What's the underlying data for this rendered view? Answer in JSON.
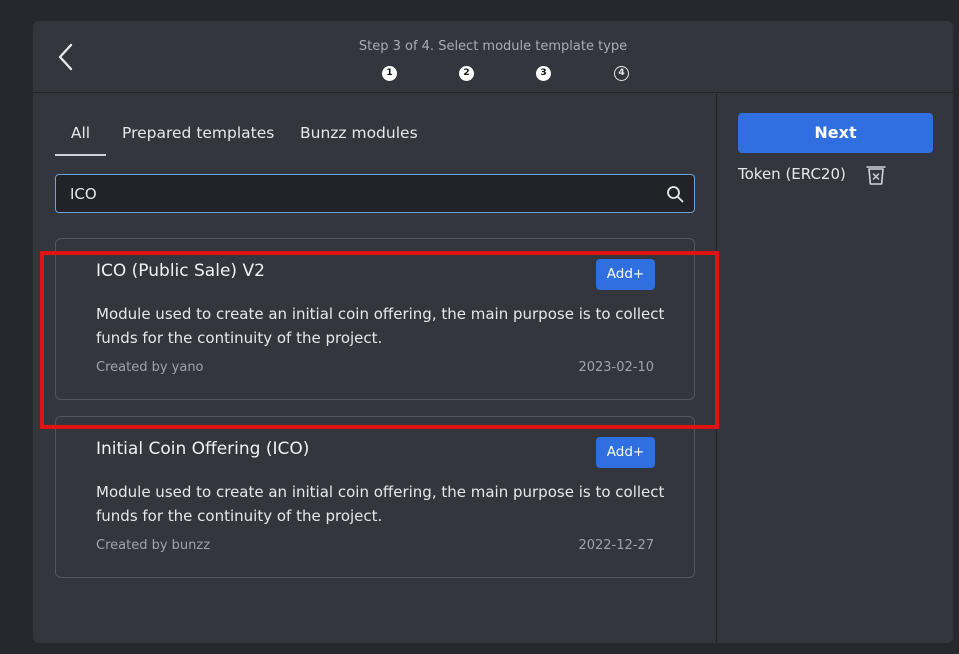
{
  "header": {
    "step_title": "Step 3 of 4. Select module template type",
    "steps": [
      "1",
      "2",
      "3",
      "4"
    ],
    "back_icon": "chevron-left-icon"
  },
  "tabs": [
    {
      "label": "All",
      "active": true
    },
    {
      "label": "Prepared templates",
      "active": false
    },
    {
      "label": "Bunzz modules",
      "active": false
    }
  ],
  "search": {
    "value": "ICO",
    "icon": "search-icon"
  },
  "cards": [
    {
      "title": "ICO (Public Sale) V2",
      "add_label": "Add+",
      "description": "Module used to create an initial coin offering, the main purpose is to collect funds for the continuity of the project.",
      "author": "Created by yano",
      "date": "2023-02-10"
    },
    {
      "title": "Initial Coin Offering (ICO)",
      "add_label": "Add+",
      "description": "Module used to create an initial coin offering, the main purpose is to collect funds for the continuity of the project.",
      "author": "Created by bunzz",
      "date": "2022-12-27"
    }
  ],
  "sidebar": {
    "next_label": "Next",
    "selected_label": "Token (ERC20)",
    "remove_icon": "trash-icon"
  },
  "colors": {
    "accent": "#2f6fe0",
    "highlight": "#e21212",
    "panel": "#33363c",
    "background": "#26282d"
  }
}
